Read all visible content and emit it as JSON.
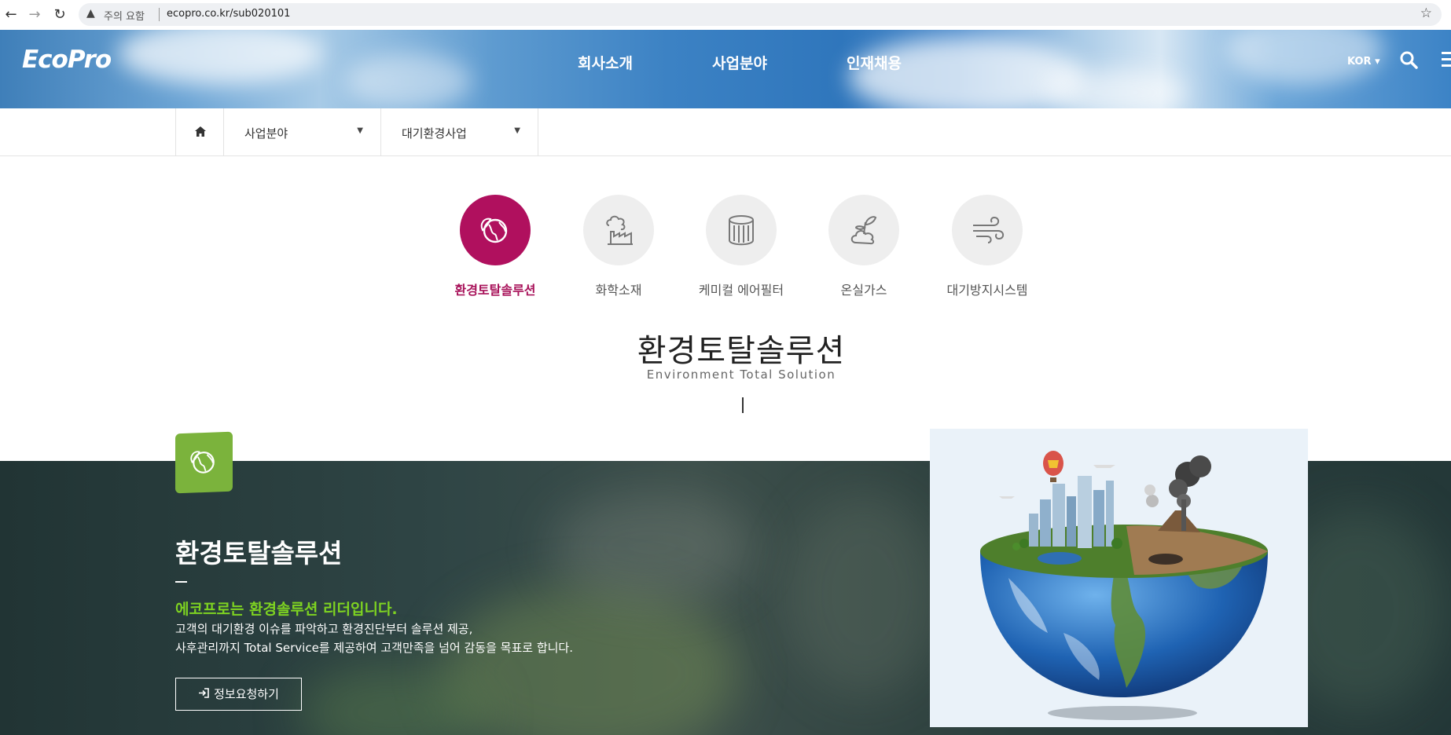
{
  "browser": {
    "warning": "주의 요함",
    "url": "ecopro.co.kr/sub020101"
  },
  "header": {
    "logo": "EcoPro",
    "nav": [
      "회사소개",
      "사업분야",
      "인재채용"
    ],
    "lang": "KOR ▾"
  },
  "subnav": {
    "level1": "사업분야",
    "level2": "대기환경사업"
  },
  "categories": [
    {
      "label": "환경토탈솔루션",
      "icon": "globe-leaf-icon",
      "active": true
    },
    {
      "label": "화학소재",
      "icon": "factory-icon",
      "active": false
    },
    {
      "label": "케미컬 에어필터",
      "icon": "filter-cartridge-icon",
      "active": false
    },
    {
      "label": "온실가스",
      "icon": "sprout-cloud-icon",
      "active": false
    },
    {
      "label": "대기방지시스템",
      "icon": "wind-icon",
      "active": false
    }
  ],
  "page": {
    "title": "환경토탈솔루션",
    "subtitle": "Environment Total Solution"
  },
  "section": {
    "title": "환경토탈솔루션",
    "lead": "에코프로는 환경솔루션 리더입니다.",
    "desc_line1": "고객의 대기환경 이슈를 파악하고 환경진단부터 솔루션 제공,",
    "desc_line2": "사후관리까지 Total Service를 제공하여 고객만족을 넘어 감동을 목표로 합니다.",
    "button": "정보요청하기"
  },
  "colors": {
    "accent": "#b0105e",
    "lead_green": "#7ed321",
    "icon_green": "#7bb33c"
  }
}
